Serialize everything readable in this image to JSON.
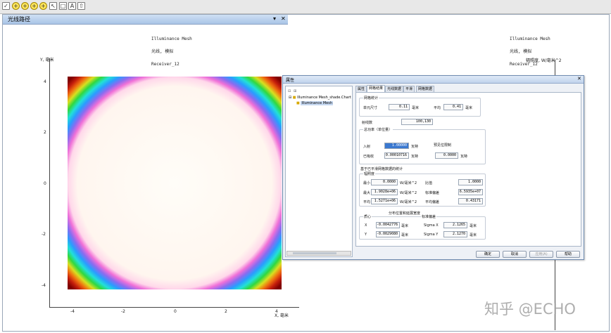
{
  "window": {
    "title": "光线路径",
    "close": "✕",
    "pin": "▾"
  },
  "toolbar": {
    "buttons": [
      "✓",
      "+",
      "+",
      "+",
      "+",
      "↖",
      "□",
      "A",
      "⇧"
    ]
  },
  "plot_left": {
    "header_lines": [
      "Illuminance Mesh",
      "光线, 模拟",
      "Receiver_12"
    ],
    "y_axis_label": "Y, 毫米",
    "x_axis_label": "X, 毫米",
    "y_ticks": [
      "4",
      "2",
      "0",
      "-2",
      "-4"
    ],
    "x_ticks": [
      "-4",
      "-2",
      "0",
      "2",
      "4"
    ]
  },
  "plot_right": {
    "header_lines": [
      "Illuminance Mesh",
      "光线, 模拟",
      "Receiver_12"
    ],
    "axis_label": "辐照度, W/毫米^2"
  },
  "dialog": {
    "title": "属性",
    "tree": {
      "items": [
        {
          "expander": "⊟",
          "label": "Illuminance Mesh_shade.Chart"
        },
        {
          "expander": "",
          "label": "Illuminance Mesh"
        }
      ]
    },
    "tabs": [
      "属性",
      "网格结果",
      "光线数据",
      "平滑",
      "网格数据"
    ],
    "active_tab": 1,
    "content": {
      "section_title": "网格统计",
      "cell_size_label": "单元尺寸",
      "cell_x": "0.11",
      "cell_y_label": "平均",
      "cell_y": "0.41",
      "unit_mm": "毫米",
      "ray_count_label": "射线数",
      "ray_count": "100,130",
      "total_power_label": "总功率（单位量）",
      "incident_label": "入射",
      "incident_value": "1.00000",
      "incident_unit": "瓦特",
      "absorbed_label": "已吸收",
      "absorbed_value": "0.00010716",
      "absorbed_unit": "瓦特",
      "threshold_label": "预见位限制",
      "threshold_value": "0.0000",
      "threshold_unit": "瓦特",
      "stats_title": "基于已平滑网格数据的统计",
      "irradiance_label": "辐照度",
      "min_label": "最小",
      "min_value": "0.0000",
      "min_unit": "W/毫米^2",
      "max_label": "最大",
      "max_value": "1.9028e+06",
      "max_unit": "W/毫米^2",
      "avg_label": "平均",
      "avg_value": "1.5271e+06",
      "avg_unit": "W/毫米^2",
      "ratio_label": "比值",
      "ratio_value": "1.0000",
      "std_label": "标准偏差",
      "std_value": "6.5935e+07",
      "uniform_label": "平均偏差",
      "uniform_value": "0.43171",
      "centroid_title": "分布位置和延展宽度",
      "centroid_label": "质心",
      "std_dev_label": "标准偏差",
      "centroid_x_label": "X",
      "centroid_x": "-0.0042776",
      "centroid_y_label": "Y",
      "centroid_y": "-0.0029080",
      "sigma_x_label": "Sigma X",
      "sigma_x": "2.1265",
      "sigma_y_label": "Sigma Y",
      "sigma_y": "2.1270",
      "mm": "毫米"
    },
    "buttons": [
      "确定",
      "取消",
      "应用(A)",
      "帮助"
    ]
  },
  "watermark": "知乎 @ECHO"
}
